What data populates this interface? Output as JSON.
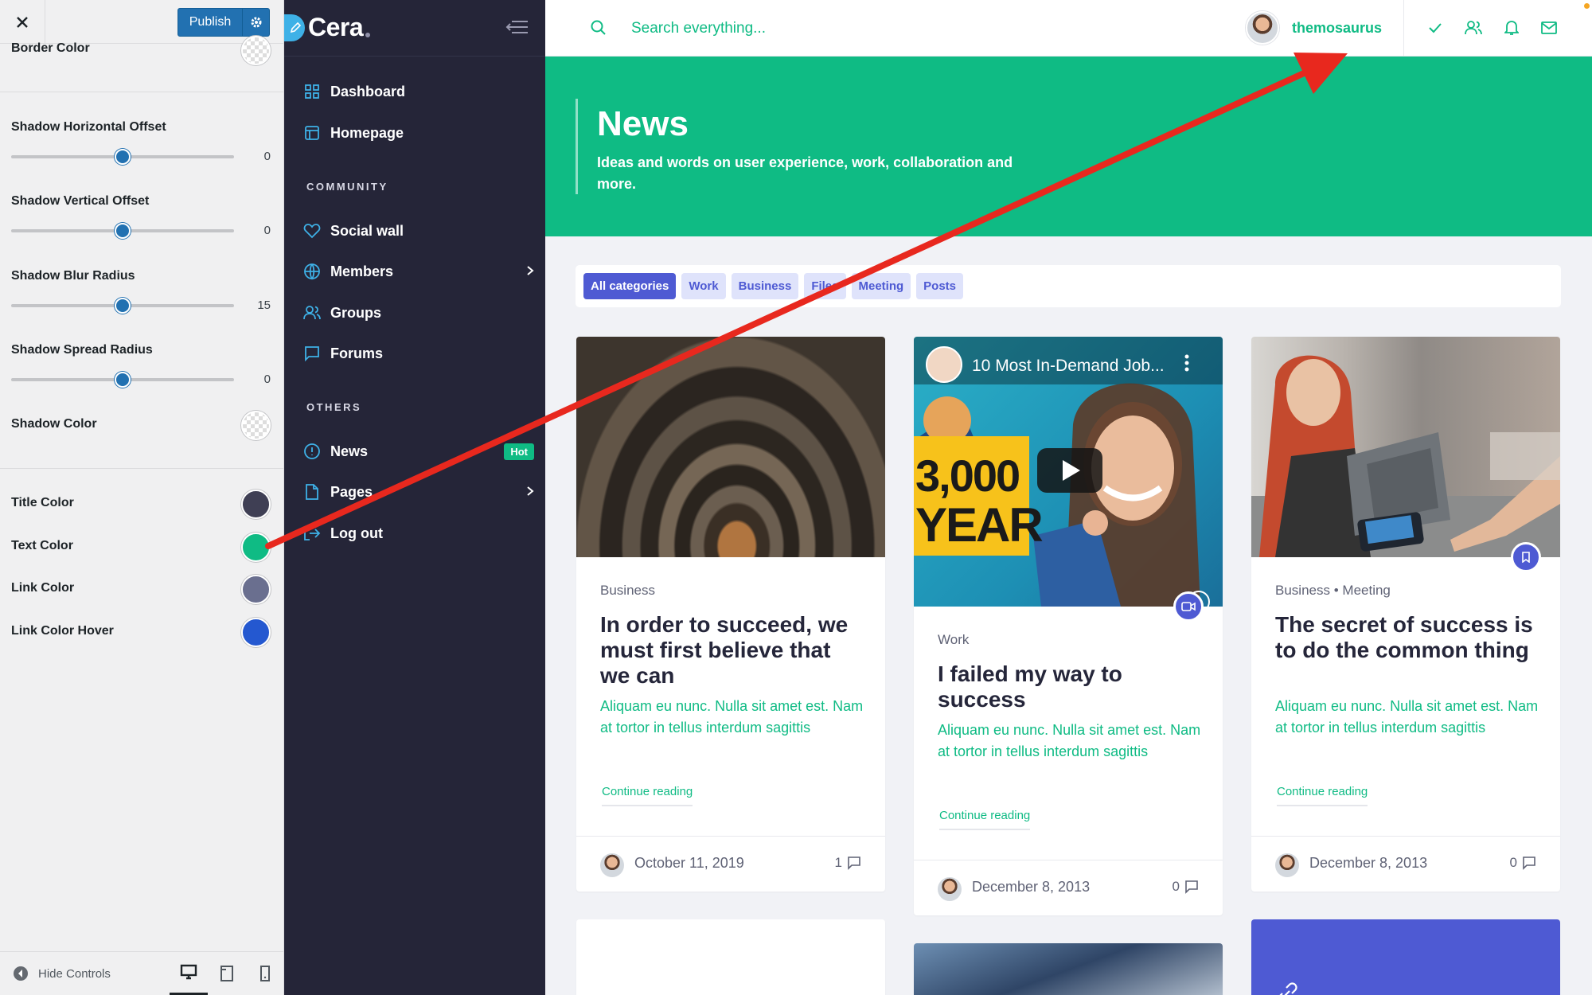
{
  "customizer": {
    "publish_label": "Publish",
    "rows": [
      {
        "label": "Border Color"
      },
      {
        "label": "Shadow Horizontal Offset",
        "value": "0",
        "level": 0.5
      },
      {
        "label": "Shadow Vertical Offset",
        "value": "0",
        "level": 0.5
      },
      {
        "label": "Shadow Blur Radius",
        "value": "15",
        "level": 0.5
      },
      {
        "label": "Shadow Spread Radius",
        "value": "0",
        "level": 0.5
      },
      {
        "label": "Shadow Color"
      },
      {
        "label": "Title Color",
        "color": "#3f3f54"
      },
      {
        "label": "Text Color",
        "color": "#0fbb84"
      },
      {
        "label": "Link Color",
        "color": "#6a6f8f"
      },
      {
        "label": "Link Color Hover",
        "color": "#2458d0"
      }
    ],
    "hide_controls": "Hide Controls"
  },
  "sidebar": {
    "brand": "Cera",
    "items": [
      {
        "label": "Dashboard",
        "icon": "grid-icon"
      },
      {
        "label": "Homepage",
        "icon": "layout-icon"
      }
    ],
    "section_community": "COMMUNITY",
    "community": [
      {
        "label": "Social wall",
        "icon": "heart-icon"
      },
      {
        "label": "Members",
        "icon": "globe-icon"
      },
      {
        "label": "Groups",
        "icon": "users-icon"
      },
      {
        "label": "Forums",
        "icon": "message-icon"
      }
    ],
    "section_others": "OTHERS",
    "others": [
      {
        "label": "News",
        "icon": "info-icon",
        "badge": "Hot"
      },
      {
        "label": "Pages",
        "icon": "file-icon"
      },
      {
        "label": "Log out",
        "icon": "logout-icon"
      }
    ]
  },
  "topbar": {
    "search_placeholder": "Search everything...",
    "username": "themosaurus"
  },
  "hero": {
    "title": "News",
    "subtitle": "Ideas and words on user experience, work, collaboration and more."
  },
  "filters": [
    "All categories",
    "Work",
    "Business",
    "Files",
    "Meeting",
    "Posts"
  ],
  "cards": [
    {
      "category": "Business",
      "title": "In order to succeed, we must first believe that we can",
      "text": "Aliquam eu nunc. Nulla sit amet est. Nam at tortor in tellus interdum sagittis",
      "link": "Continue reading",
      "date": "October 11, 2019",
      "comments": "1"
    },
    {
      "video_title": "10 Most In-Demand Job...",
      "video_overlay_a": "3,000",
      "video_overlay_b": "YEAR",
      "category": "Work",
      "title": "I failed my way to success",
      "text": "Aliquam eu nunc. Nulla sit amet est. Nam at tortor in tellus interdum sagittis",
      "link": "Continue reading",
      "date": "December 8, 2013",
      "comments": "0"
    },
    {
      "category": "Business",
      "category2": "Meeting",
      "title": "The secret of success is to do the common thing",
      "text": "Aliquam eu nunc. Nulla sit amet est. Nam at tortor in tellus interdum sagittis",
      "link": "Continue reading",
      "date": "December 8, 2013",
      "comments": "0"
    }
  ],
  "colors": {
    "accent": "#0fbb84",
    "sidebar_bg": "#252538",
    "chip": "#4e5ad3",
    "arrow": "#e8281e"
  }
}
